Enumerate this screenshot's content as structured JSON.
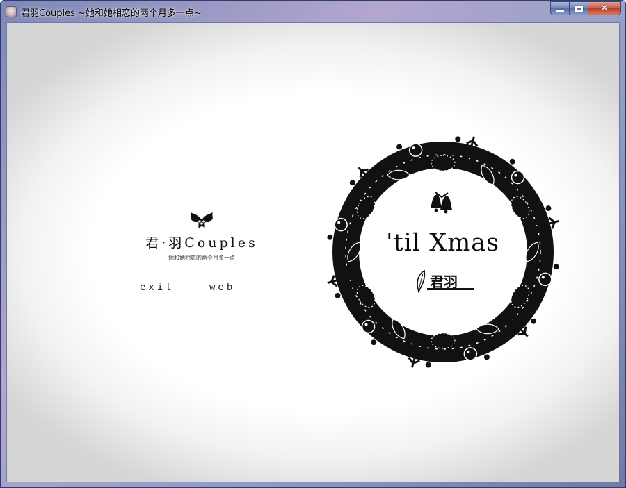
{
  "window": {
    "title": "君羽Couples ~她和她相恋的两个月多一点~",
    "icon": "app-portrait-icon",
    "controls": {
      "minimize": "minimize-icon",
      "maximize": "maximize-icon",
      "close": "✕"
    }
  },
  "logo": {
    "icon": "holly-icon",
    "title": "君·羽Couples",
    "subtitle": "她和她相恋的两个月多一点"
  },
  "menu": {
    "exit_label": "exit",
    "web_label": "web"
  },
  "wreath": {
    "icon": "christmas-wreath-icon",
    "bell_icon": "bells-icon",
    "text": "'til Xmas",
    "signature": "君羽",
    "signature_icon": "feather-icon"
  },
  "colors": {
    "ink": "#111111",
    "background": "#ffffff",
    "frame": "#8f9cc4"
  }
}
